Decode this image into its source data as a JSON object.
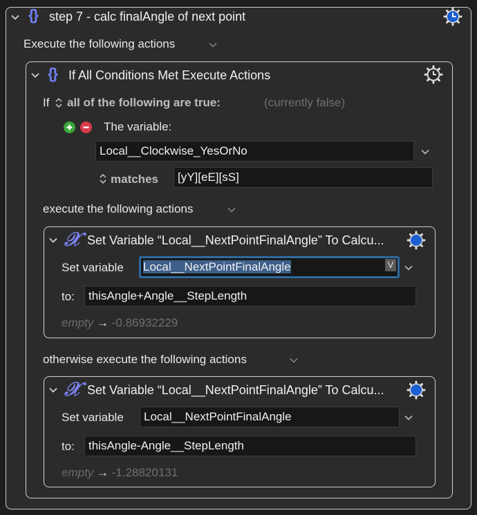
{
  "outer": {
    "title": "step 7 - calc finalAngle of next point",
    "section_label": "Execute the following actions"
  },
  "if_action": {
    "title": "If All Conditions Met Execute Actions",
    "if_label": "If",
    "condition_mode": "all of the following are true:",
    "status": "(currently false)",
    "condition": {
      "label": "The variable:",
      "variable": "Local__Clockwise_YesOrNo",
      "operator": "matches",
      "value": "[yY][eE][sS]"
    },
    "then_label": "execute the following actions",
    "else_label": "otherwise execute the following actions"
  },
  "then_action": {
    "title": "Set Variable “Local__NextPointFinalAngle” To Calcu...",
    "set_label": "Set variable",
    "variable": "Local__NextPointFinalAngle",
    "var_badge": "V",
    "to_label": "to:",
    "expression": "thisAngle+Angle__StepLength",
    "preview_from": "empty",
    "preview_arrow": "→",
    "preview_value": "-0.86932229"
  },
  "else_action": {
    "title": "Set Variable “Local__NextPointFinalAngle” To Calcu...",
    "set_label": "Set variable",
    "variable": "Local__NextPointFinalAngle",
    "to_label": "to:",
    "expression": "thisAngle-Angle__StepLength",
    "preview_from": "empty",
    "preview_arrow": "→",
    "preview_value": "-1.28820131"
  },
  "icons": {
    "group": "braces-icon",
    "set_variable": "variable-x-icon",
    "gear_clock": "gear-clock-icon",
    "gear_enabled": "gear-enabled-icon",
    "add": "plus-icon",
    "remove": "minus-icon"
  },
  "colors": {
    "accent_blue": "#1b5fd1",
    "brace_purple": "#6f7ff0",
    "focus_ring": "#2f6aa0",
    "add_green": "#3aa53a",
    "remove_red": "#d83a4a"
  }
}
